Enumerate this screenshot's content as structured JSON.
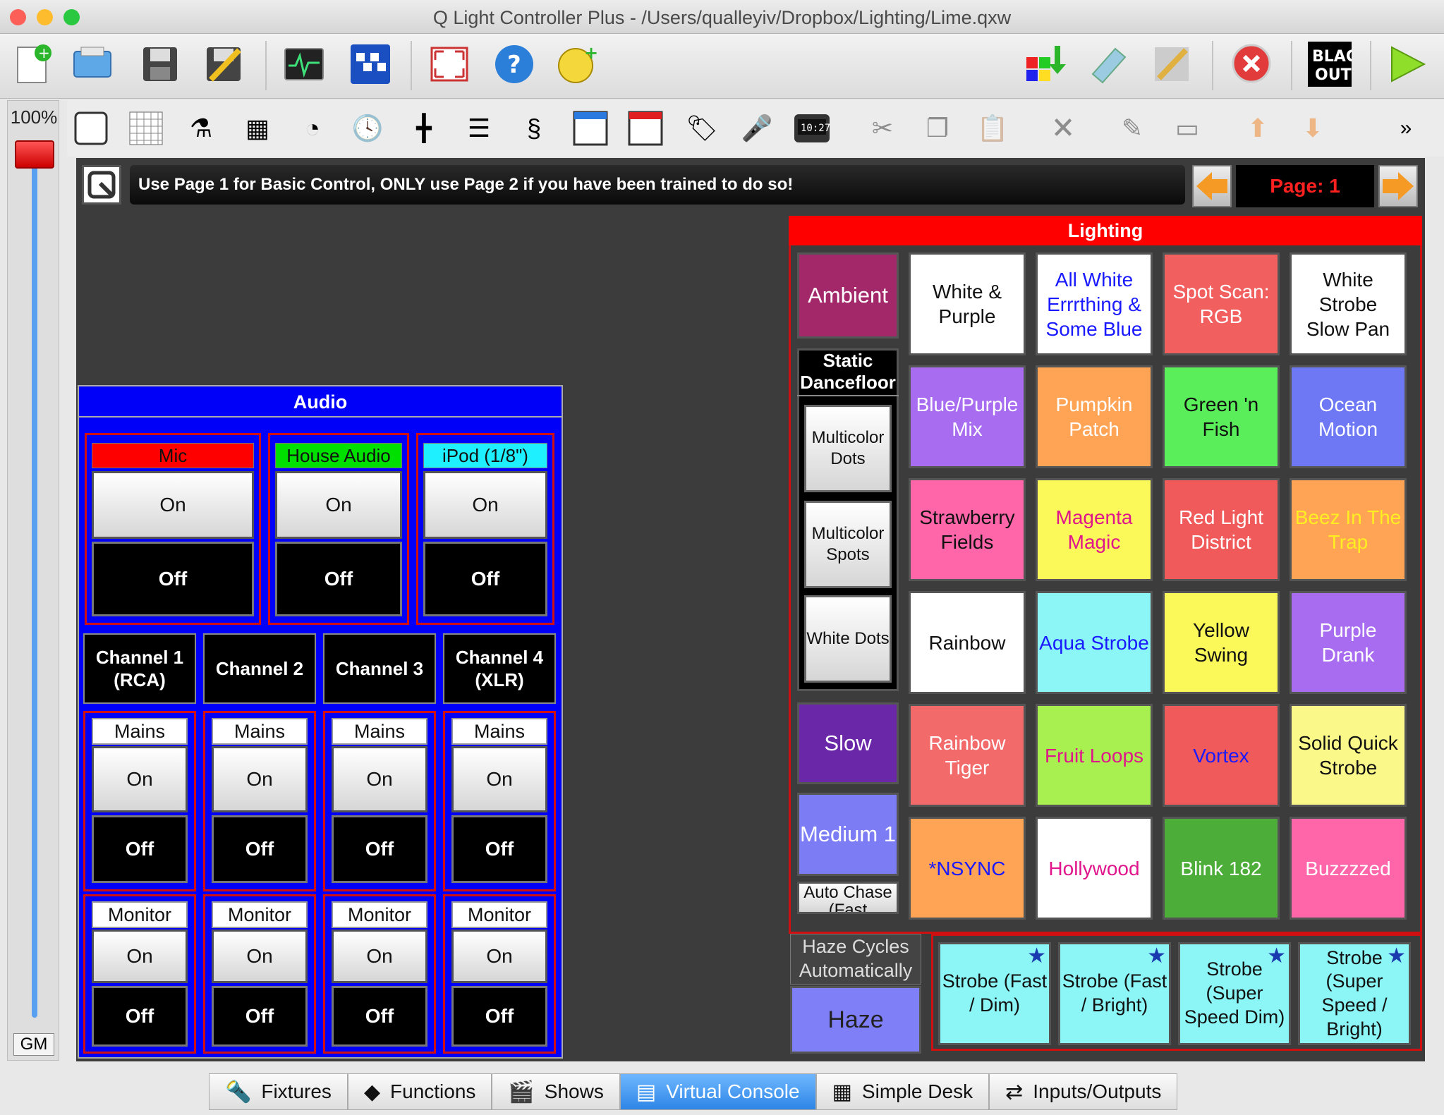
{
  "window": {
    "title": "Q Light Controller Plus - /Users/qualleyiv/Dropbox/Lighting/Lime.qxw"
  },
  "gm": {
    "percent": "100%",
    "label": "GM",
    "level": 1.0
  },
  "banner": {
    "text": "Use Page 1 for Basic Control, ONLY use Page 2 if you have been trained to do so!",
    "page_label": "Page: 1"
  },
  "audio": {
    "title": "Audio",
    "sources": [
      {
        "label": "Mic",
        "color": "#ff0000",
        "on": "On",
        "off": "Off"
      },
      {
        "label": "House Audio",
        "color": "#00e000",
        "on": "On",
        "off": "Off"
      },
      {
        "label": "iPod (1/8\")",
        "color": "#1ff0ff",
        "on": "On",
        "off": "Off"
      }
    ],
    "channels": [
      "Channel 1\n(RCA)",
      "Channel 2",
      "Channel 3",
      "Channel 4\n(XLR)"
    ],
    "mains": {
      "label": "Mains",
      "on": "On",
      "off": "Off"
    },
    "monitor": {
      "label": "Monitor",
      "on": "On",
      "off": "Off"
    }
  },
  "lighting": {
    "title": "Lighting",
    "ambient": "Ambient",
    "static_title": "Static\nDancefloor",
    "static_buttons": [
      "Multicolor\nDots",
      "Multicolor\nSpots",
      "White Dots"
    ],
    "speed_buttons": [
      "Slow",
      "Medium 1",
      "Auto Chase\n(Fast"
    ],
    "grid": [
      [
        {
          "t": "White &\nPurple",
          "bg": "#ffffff",
          "fg": "#111111"
        },
        {
          "t": "All White\nErrrthing &\nSome Blue",
          "bg": "#ffffff",
          "fg": "#1a1aff"
        },
        {
          "t": "Spot Scan:\nRGB",
          "bg": "#f25f5f",
          "fg": "#ffffff"
        },
        {
          "t": "White Strobe\nSlow Pan",
          "bg": "#ffffff",
          "fg": "#111111"
        }
      ],
      [
        {
          "t": "Blue/Purple\nMix",
          "bg": "#a86cf0",
          "fg": "#ffffff"
        },
        {
          "t": "Pumpkin\nPatch",
          "bg": "#ffa455",
          "fg": "#ffffff"
        },
        {
          "t": "Green 'n Fish",
          "bg": "#5aee5a",
          "fg": "#111111"
        },
        {
          "t": "Ocean\nMotion",
          "bg": "#6e78f5",
          "fg": "#ffffff"
        }
      ],
      [
        {
          "t": "Strawberry\nFields",
          "bg": "#ff66aa",
          "fg": "#111111"
        },
        {
          "t": "Magenta\nMagic",
          "bg": "#fbf85a",
          "fg": "#e0158c"
        },
        {
          "t": "Red Light\nDistrict",
          "bg": "#f05a5a",
          "fg": "#ffffff"
        },
        {
          "t": "Beez In The\nTrap",
          "bg": "#ffa455",
          "fg": "#ffee22"
        }
      ],
      [
        {
          "t": "Rainbow",
          "bg": "#ffffff",
          "fg": "#111111"
        },
        {
          "t": "Aqua Strobe",
          "bg": "#8cf6f6",
          "fg": "#1a1aff"
        },
        {
          "t": "Yellow Swing",
          "bg": "#fbf85a",
          "fg": "#111111"
        },
        {
          "t": "Purple Drank",
          "bg": "#a86cf0",
          "fg": "#ffffff"
        }
      ],
      [
        {
          "t": "Rainbow\nTiger",
          "bg": "#f26a6a",
          "fg": "#ffffff"
        },
        {
          "t": "Fruit Loops",
          "bg": "#a8f050",
          "fg": "#e0158c"
        },
        {
          "t": "Vortex",
          "bg": "#f05a5a",
          "fg": "#1a1aff"
        },
        {
          "t": "Solid Quick\nStrobe",
          "bg": "#fbf88a",
          "fg": "#111111"
        }
      ],
      [
        {
          "t": "*NSYNC",
          "bg": "#ffa455",
          "fg": "#1a1aff"
        },
        {
          "t": "Hollywood",
          "bg": "#ffffff",
          "fg": "#e0158c"
        },
        {
          "t": "Blink 182",
          "bg": "#4cae38",
          "fg": "#ffffff"
        },
        {
          "t": "Buzzzzed",
          "bg": "#ff66aa",
          "fg": "#ffffff"
        }
      ]
    ],
    "haze_label": "Haze Cycles\nAutomatically",
    "haze_button": "Haze",
    "strobes": [
      "Strobe (Fast\n/ Dim)",
      "Strobe (Fast\n/ Bright)",
      "Strobe\n(Super\nSpeed Dim)",
      "Strobe\n(Super\nSpeed /\nBright)"
    ]
  },
  "tabs": [
    "Fixtures",
    "Functions",
    "Shows",
    "Virtual Console",
    "Simple Desk",
    "Inputs/Outputs"
  ],
  "active_tab": "Virtual Console"
}
